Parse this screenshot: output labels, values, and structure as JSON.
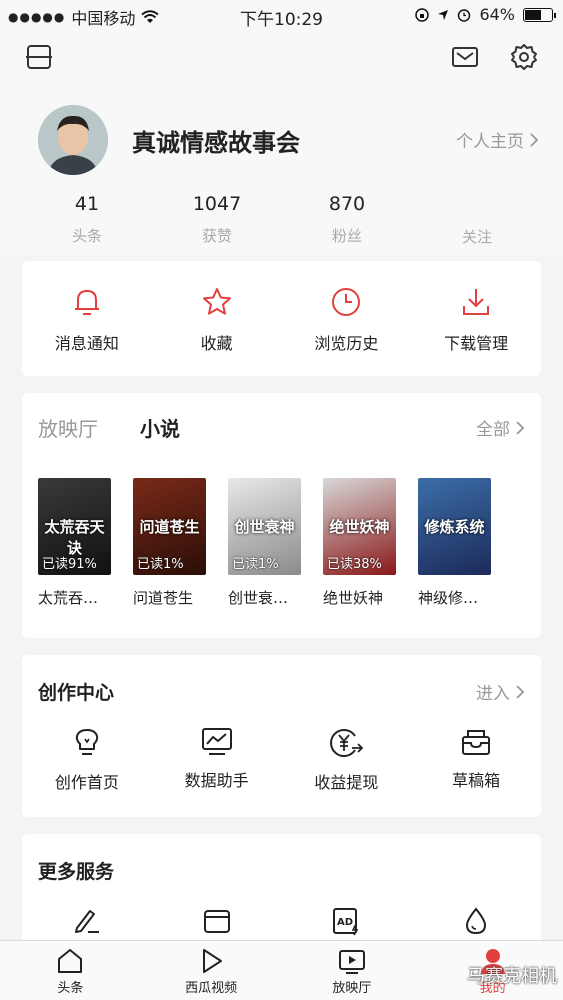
{
  "status": {
    "carrier": "中国移动",
    "time": "下午10:29",
    "battery": "64%",
    "battery_level": 0.64
  },
  "profile": {
    "name": "真诚情感故事会",
    "homepage_label": "个人主页",
    "stats": [
      {
        "num": "41",
        "label": "头条"
      },
      {
        "num": "1047",
        "label": "获赞"
      },
      {
        "num": "870",
        "label": "粉丝"
      },
      {
        "num": "",
        "label": "关注"
      }
    ]
  },
  "quick_actions": [
    "消息通知",
    "收藏",
    "浏览历史",
    "下载管理"
  ],
  "books": {
    "tabs": [
      "放映厅",
      "小说"
    ],
    "see_all": "全部",
    "items": [
      {
        "title": "太荒吞…",
        "read": "已读91%",
        "cover_text": "太荒吞天诀",
        "color_a": "#3a3a3a",
        "color_b": "#111"
      },
      {
        "title": "问道苍生",
        "read": "已读1%",
        "cover_text": "问道苍生",
        "color_a": "#7a2a18",
        "color_b": "#2a0e08"
      },
      {
        "title": "创世衰…",
        "read": "已读1%",
        "cover_text": "创世衰神",
        "color_a": "#e8e8e8",
        "color_b": "#8a8a8a"
      },
      {
        "title": "绝世妖神",
        "read": "已读38%",
        "cover_text": "绝世妖神",
        "color_a": "#d8d8d8",
        "color_b": "#8a1818"
      },
      {
        "title": "神级修…",
        "read": "",
        "cover_text": "修炼系统",
        "color_a": "#3c6ea8",
        "color_b": "#1c2a5a"
      }
    ]
  },
  "creation": {
    "title": "创作中心",
    "enter": "进入",
    "items": [
      "创作首页",
      "数据助手",
      "收益提现",
      "草稿箱"
    ]
  },
  "more": {
    "title": "更多服务"
  },
  "tabbar": [
    {
      "label": "头条"
    },
    {
      "label": "西瓜视频"
    },
    {
      "label": "放映厅"
    },
    {
      "label": "我的"
    }
  ],
  "watermark": "马赛克相机",
  "accent": "#e0403e"
}
